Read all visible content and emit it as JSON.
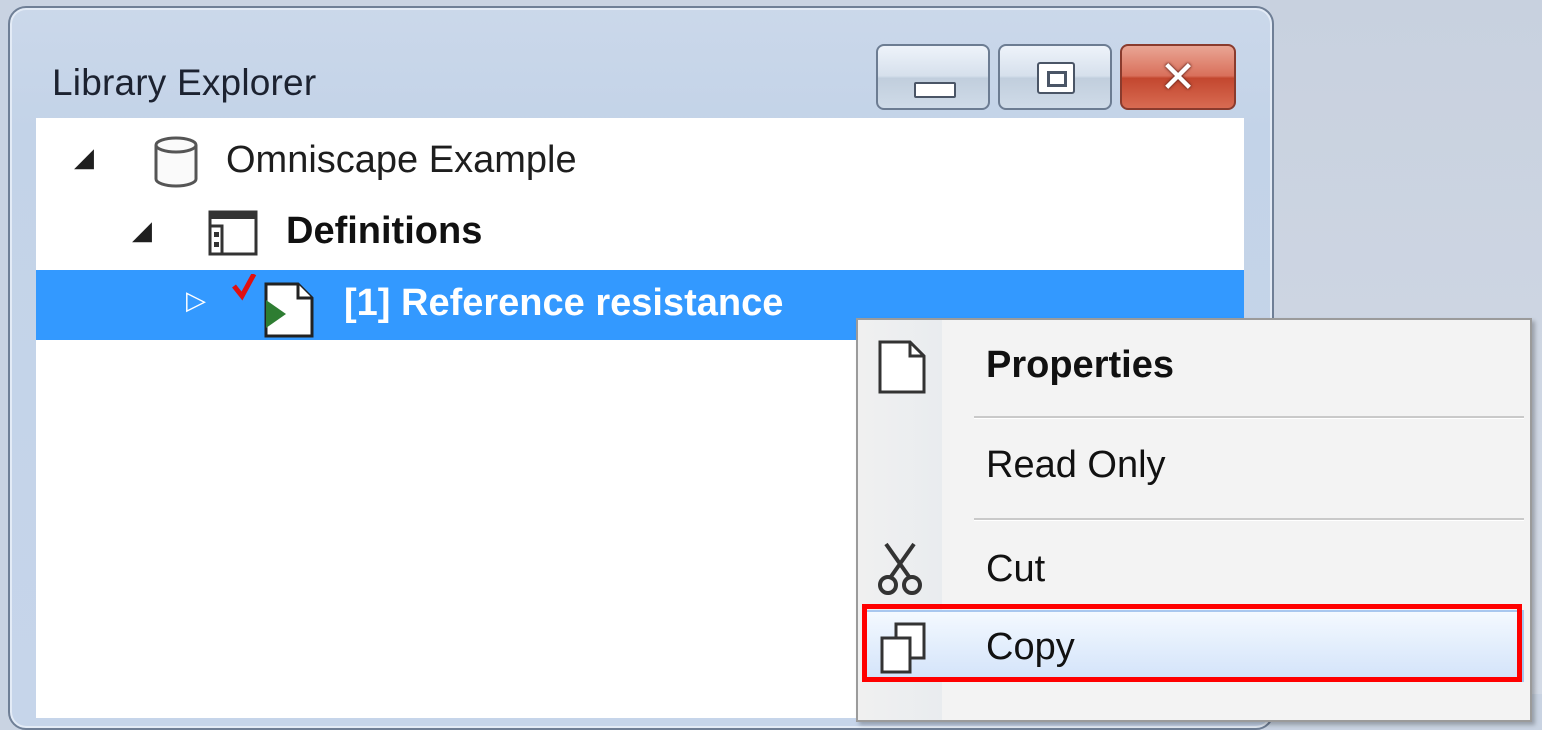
{
  "window": {
    "title": "Library Explorer",
    "buttons": {
      "minimize": "minimize-icon",
      "maximize": "restore-icon",
      "close": "close-icon"
    }
  },
  "tree": {
    "items": [
      {
        "expander": "◢",
        "icon": "database-icon",
        "label": "Omniscape Example",
        "bold": false,
        "selected": false
      },
      {
        "expander": "◢",
        "icon": "definitions-icon",
        "label": "Definitions",
        "bold": true,
        "selected": false
      },
      {
        "expander": "▷",
        "icon": "scenario-checked-icon",
        "label": "[1] Reference resistance",
        "bold": true,
        "selected": true
      }
    ]
  },
  "context_menu": {
    "items": [
      {
        "label": "Properties",
        "icon": "document-icon",
        "bold": true
      },
      {
        "label": "Read Only",
        "icon": "",
        "bold": false
      },
      {
        "label": "Cut",
        "icon": "scissors-icon",
        "bold": false
      },
      {
        "label": "Copy",
        "icon": "copy-icon",
        "bold": false,
        "highlighted": true
      }
    ]
  },
  "colors": {
    "selection": "#3399ff",
    "highlight_box": "#ff0000",
    "close_button": "#c8452d"
  }
}
